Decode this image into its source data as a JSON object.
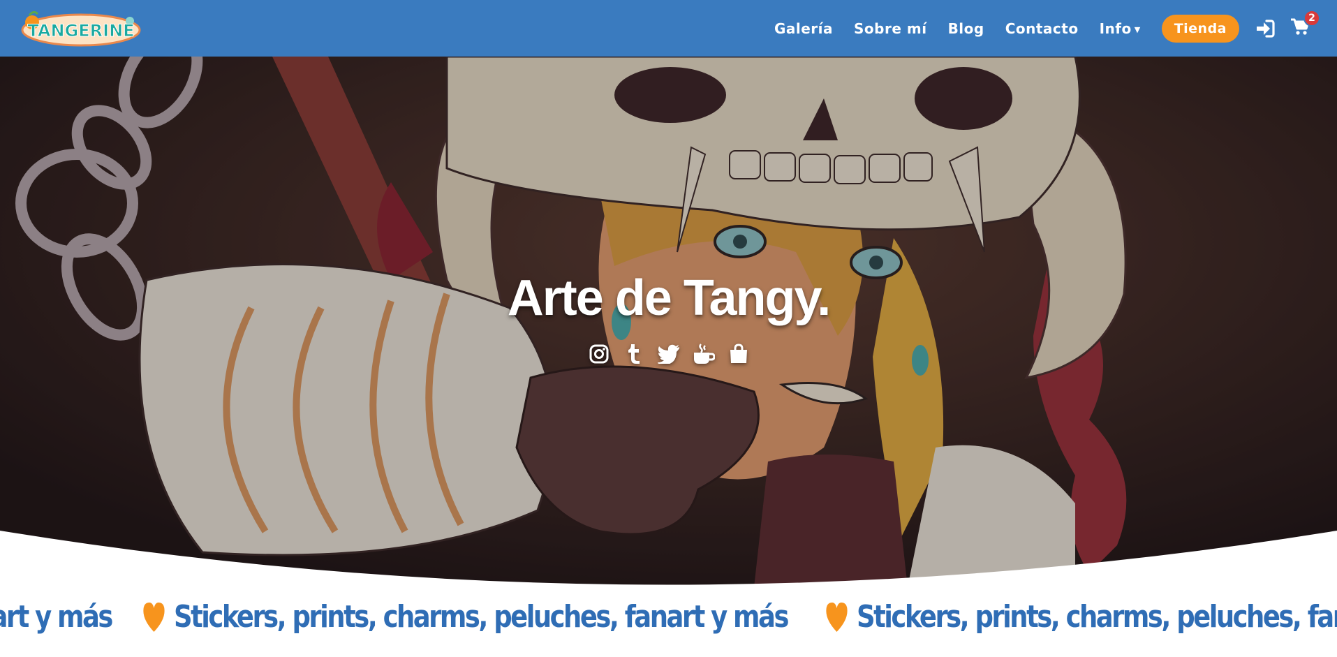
{
  "nav": {
    "logo_text": "TANGERINE",
    "links": [
      "Galería",
      "Sobre mí",
      "Blog",
      "Contacto",
      "Info"
    ],
    "shop_label": "Tienda",
    "cart_count": "2",
    "icons": [
      "login-icon",
      "cart-icon",
      "caret-down-icon"
    ]
  },
  "hero": {
    "title": "Arte de Tangy.",
    "social_icons": [
      "instagram-icon",
      "tumblr-icon",
      "twitter-icon",
      "kofi-icon",
      "shop-bag-icon"
    ]
  },
  "marquee": {
    "text_1": "Stickers, prints, charms, peluches, fanart y más",
    "text_2": "Stickers, prints, charms, peluches, fanart y más",
    "text_3": "Stickers, prints, charms, peluches, fanart y más",
    "icon": "heart-icon"
  },
  "colors": {
    "nav_bg": "#3a7bbf",
    "accent_orange": "#f7941d",
    "marquee_text": "#2f6db5",
    "badge": "#d93a3a"
  }
}
